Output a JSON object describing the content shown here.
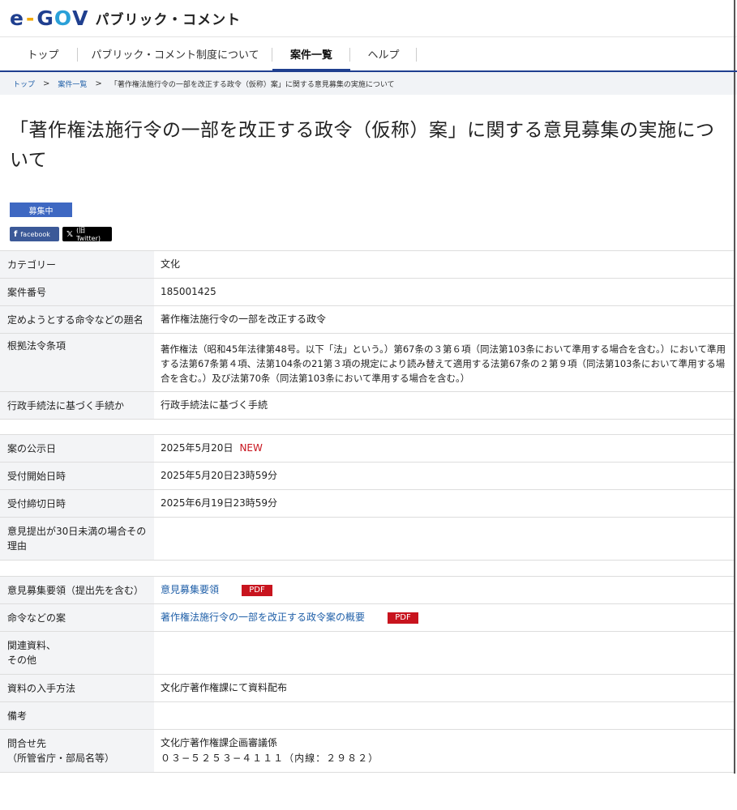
{
  "header": {
    "logo": {
      "e": "e",
      "dash": "-",
      "go_g": "G",
      "go_o": "O",
      "go_v": "V"
    },
    "site_name": "パブリック・コメント"
  },
  "nav": [
    {
      "label": "トップ"
    },
    {
      "label": "パブリック・コメント制度について"
    },
    {
      "label": "案件一覧",
      "active": true
    },
    {
      "label": "ヘルプ"
    }
  ],
  "breadcrumb": {
    "items": [
      "トップ",
      "案件一覧",
      "「著作権法施行令の一部を改正する政令（仮称）案」に関する意見募集の実施について"
    ],
    "separator": ">"
  },
  "page": {
    "title": "「著作権法施行令の一部を改正する政令（仮称）案」に関する意見募集の実施について",
    "status": "募集中",
    "share_facebook": "facebook",
    "share_x": "(旧Twitter)"
  },
  "details": [
    {
      "label": "カテゴリー",
      "value": "文化"
    },
    {
      "label": "案件番号",
      "value": "185001425"
    },
    {
      "label": "定めようとする命令などの題名",
      "value": "著作権法施行令の一部を改正する政令"
    },
    {
      "label": "根拠法令条項",
      "value": "著作権法（昭和45年法律第48号。以下「法」という。）第67条の３第６項（同法第103条において準用する場合を含む。）において準用する法第67条第４項、法第104条の21第３項の規定により読み替えて適用する法第67条の２第９項（同法第103条において準用する場合を含む。）及び法第70条（同法第103条において準用する場合を含む。）"
    },
    {
      "label": "行政手続法に基づく手続か",
      "value": "行政手続法に基づく手続"
    }
  ],
  "dates": [
    {
      "label": "案の公示日",
      "value": "2025年5月20日",
      "badge": "NEW"
    },
    {
      "label": "受付開始日時",
      "value": "2025年5月20日23時59分"
    },
    {
      "label": "受付締切日時",
      "value": "2025年6月19日23時59分"
    },
    {
      "label": "意見提出が30日未満の場合その理由",
      "value": ""
    }
  ],
  "documents": {
    "guidelines_label": "意見募集要領（提出先を含む）",
    "guidelines_link": "意見募集要領",
    "draft_label": "命令などの案",
    "draft_link": "著作権法施行令の一部を改正する政令案の概要",
    "pdf": "PDF",
    "related_label_1": "関連資料、",
    "related_label_2": "その他",
    "related_value": "",
    "obtain_label": "資料の入手方法",
    "obtain_value": "文化庁著作権課にて資料配布",
    "remarks_label": "備考",
    "remarks_value": "",
    "contact_label_1": "問合せ先",
    "contact_label_2": "（所管省庁・部局名等）",
    "contact_value_1": "文化庁著作権課企画審議係",
    "contact_value_2": "０３−５２５３−４１１１（内線：２９８２）"
  },
  "colors": {
    "brand_blue": "#1f3f8f",
    "link": "#1f5fa8",
    "pdf_red": "#c8141e",
    "status_blue": "#3e68c2"
  }
}
